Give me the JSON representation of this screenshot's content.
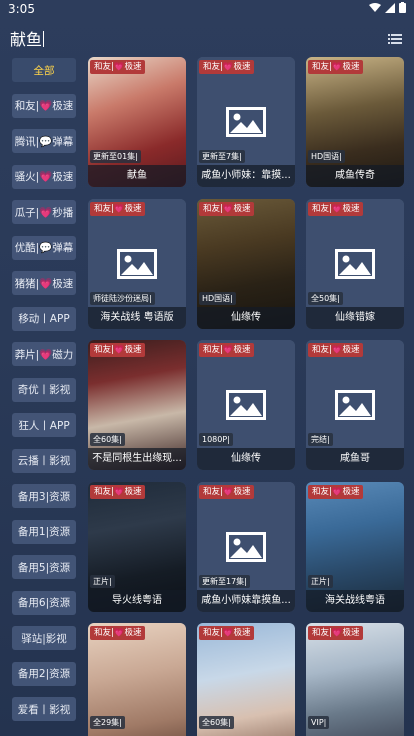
{
  "status_bar": {
    "time": "3:05"
  },
  "search": {
    "query": "献鱼"
  },
  "sidebar": {
    "items": [
      {
        "label": "全部",
        "active": true
      },
      {
        "label": "和友|💗极速"
      },
      {
        "label": "腾讯|💬弹幕"
      },
      {
        "label": "骚火|💗极速"
      },
      {
        "label": "瓜子|💗秒播"
      },
      {
        "label": "优酷|💬弹幕"
      },
      {
        "label": "猪猪|💗极速"
      },
      {
        "label": "移动丨APP"
      },
      {
        "label": "莽片|💗磁力"
      },
      {
        "label": "奇优丨影视"
      },
      {
        "label": "狂人丨APP"
      },
      {
        "label": "云播丨影视"
      },
      {
        "label": "备用3|资源"
      },
      {
        "label": "备用1|资源"
      },
      {
        "label": "备用5|资源"
      },
      {
        "label": "备用6|资源"
      },
      {
        "label": "驿站|影视"
      },
      {
        "label": "备用2|资源"
      },
      {
        "label": "爱看丨影视"
      }
    ]
  },
  "results": [
    {
      "badge": "和友|💗极速",
      "status": "更新至01集|",
      "title": "献鱼",
      "poster": "romance-poster"
    },
    {
      "badge": "和友|💗极速",
      "status": "更新至7集|",
      "title": "咸鱼小师妹：靠摸...",
      "poster": "placeholder"
    },
    {
      "badge": "和友|💗极速",
      "status": "HD国语|",
      "title": "咸鱼传奇",
      "poster": "fish-poster"
    },
    {
      "badge": "和友|💗极速",
      "status": "师徒陆沙份迷局|",
      "title": "海关战线 粤语版",
      "poster": "placeholder"
    },
    {
      "badge": "和友|💗极速",
      "status": "HD国语|",
      "title": "仙缘传",
      "poster": "dark-fantasy-poster"
    },
    {
      "badge": "和友|💗极速",
      "status": "全50集|",
      "title": "仙缘错嫁",
      "poster": "placeholder"
    },
    {
      "badge": "和友|💗极速",
      "status": "全60集|",
      "title": "不是同根生出缘现...",
      "poster": "wedding-poster"
    },
    {
      "badge": "和友|💗极速",
      "status": "1080P|",
      "title": "仙缘传",
      "poster": "placeholder"
    },
    {
      "badge": "和友|💗极速",
      "status": "完结|",
      "title": "咸鱼哥",
      "poster": "placeholder"
    },
    {
      "badge": "和友|💗极速",
      "status": "正片|",
      "title": "导火线粤语",
      "poster": "action-poster"
    },
    {
      "badge": "和友|💗极速",
      "status": "更新至17集|",
      "title": "咸鱼小师妹靠摸鱼...",
      "poster": "placeholder"
    },
    {
      "badge": "和友|💗极速",
      "status": "正片|",
      "title": "海关战线粤语",
      "poster": "ship-poster"
    },
    {
      "badge": "和友|💗极速",
      "status": "全29集|",
      "title": "",
      "poster": "white-dress-poster"
    },
    {
      "badge": "和友|💗极速",
      "status": "全60集|",
      "title": "",
      "poster": "family-poster"
    },
    {
      "badge": "和友|💗极速",
      "status": "VIP|",
      "title": "",
      "poster": "wuxia-poster"
    }
  ],
  "colors": {
    "accent": "#ffd54a",
    "badge": "#b23a3a",
    "background": "#2d3d5c"
  }
}
